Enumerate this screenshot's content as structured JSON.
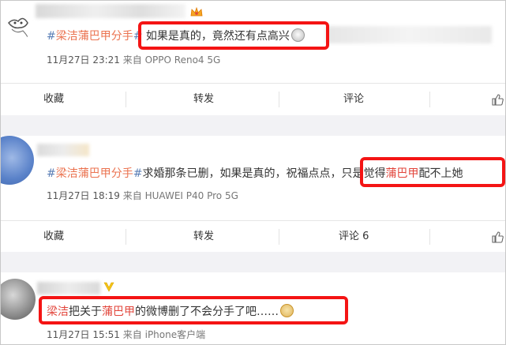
{
  "posts": [
    {
      "topic_open": "#",
      "topic_name": "梁洁蒲巴甲分手",
      "topic_close": "#",
      "content": "如果是真的，竟然还有点高兴",
      "emoji": "smile-emoji",
      "time": "11月27日 23:21",
      "source_prefix": "来自",
      "source": "OPPO Reno4 5G",
      "actions": {
        "favorite": "收藏",
        "repost": "转发",
        "comment": "评论"
      }
    },
    {
      "topic_open": "#",
      "topic_name": "梁洁蒲巴甲分手",
      "topic_close": "#",
      "content_a": "求婚那条已删，如果是真的，祝福点点，",
      "content_b": "只是觉得",
      "content_name": "蒲巴甲",
      "content_c": "配不上她",
      "time": "11月27日 18:19",
      "source_prefix": "来自",
      "source": "HUAWEI P40 Pro 5G",
      "actions": {
        "favorite": "收藏",
        "repost": "转发",
        "comment": "评论 6"
      }
    },
    {
      "name_a": "梁洁",
      "content_a": "把关于",
      "name_b": "蒲巴甲",
      "content_b": "的微博删了不会分手了吧……",
      "emoji": "doge-emoji",
      "time": "11月27日 15:51",
      "source_prefix": "来自",
      "source": "iPhone客户端"
    }
  ],
  "colors": {
    "highlight_border": "#f41414",
    "topic": "#eb7350",
    "section_gap": "#f2f2f5"
  }
}
